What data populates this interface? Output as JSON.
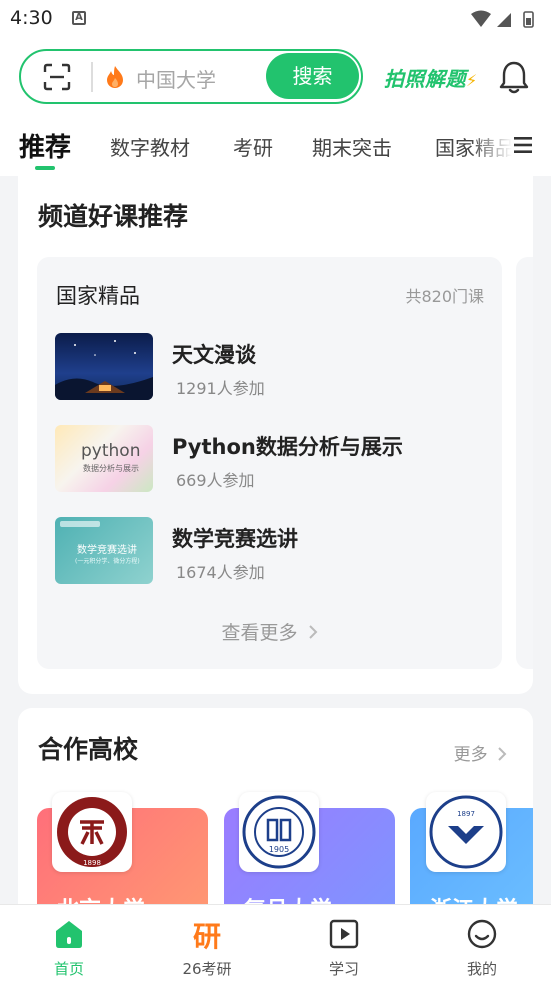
{
  "status_bar": {
    "time": "4:30",
    "notification_glyph": "A"
  },
  "header": {
    "search_placeholder": "中国大学",
    "search_button": "搜索",
    "photo_solve": "拍照解题",
    "icons": [
      "scan-icon",
      "fire-icon",
      "bell-icon"
    ]
  },
  "tabs": [
    {
      "label": "推荐",
      "active": true
    },
    {
      "label": "数字教材"
    },
    {
      "label": "考研"
    },
    {
      "label": "期末突击"
    },
    {
      "label": "国家精品"
    }
  ],
  "channel": {
    "title": "频道好课推荐",
    "group_title": "国家精品",
    "group_count": "共820门课",
    "courses": [
      {
        "name": "天文漫谈",
        "participants": "1291人参加",
        "thumb_text": ""
      },
      {
        "name": "Python数据分析与展示",
        "participants": "669人参加",
        "thumb_text": "python",
        "thumb_sub": "数据分析与展示"
      },
      {
        "name": "数学竞赛选讲",
        "participants": "1674人参加",
        "thumb_text": "数学竞赛选讲",
        "thumb_sub": "(一元积分学、微分方程)"
      }
    ],
    "more": "查看更多"
  },
  "partners": {
    "title": "合作高校",
    "more": "更多",
    "universities": [
      {
        "name": "北京大学",
        "year": "1898",
        "color": "#ff6f6f"
      },
      {
        "name": "复旦大学",
        "year": "1905",
        "color": "#8d85ff"
      },
      {
        "name": "浙江大学",
        "year": "1897",
        "color": "#5aa9ff"
      }
    ]
  },
  "bottom_nav": [
    {
      "label": "首页",
      "active": true
    },
    {
      "label": "26考研",
      "glyph": "研"
    },
    {
      "label": "学习"
    },
    {
      "label": "我的"
    }
  ],
  "colors": {
    "accent": "#22c36e",
    "orange": "#ff7a1a"
  }
}
